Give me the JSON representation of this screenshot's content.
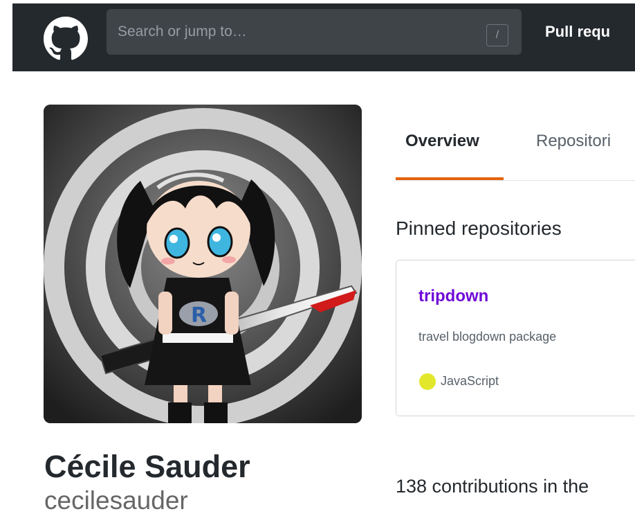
{
  "colors": {
    "header_bg": "#24292e",
    "accent_tab": "#e36209",
    "repo_link": "#6f0ad8",
    "language_dot": "#e3e72c"
  },
  "header": {
    "logo_icon": "github-octocat-icon",
    "search_placeholder": "Search or jump to…",
    "search_shortcut": "/",
    "nav_pull_requests": "Pull requ"
  },
  "profile": {
    "avatar_icon": "anime-girl-with-r-shirt-and-sword",
    "full_name": "Cécile Sauder",
    "username": "cecilesauder"
  },
  "tabs": [
    {
      "label": "Overview",
      "selected": true
    },
    {
      "label": "Repositori",
      "selected": false
    }
  ],
  "pinned": {
    "title": "Pinned repositories",
    "repos": [
      {
        "name": "tripdown",
        "description": "travel blogdown package",
        "language": "JavaScript"
      }
    ]
  },
  "contributions": {
    "text": "138 contributions in the"
  }
}
